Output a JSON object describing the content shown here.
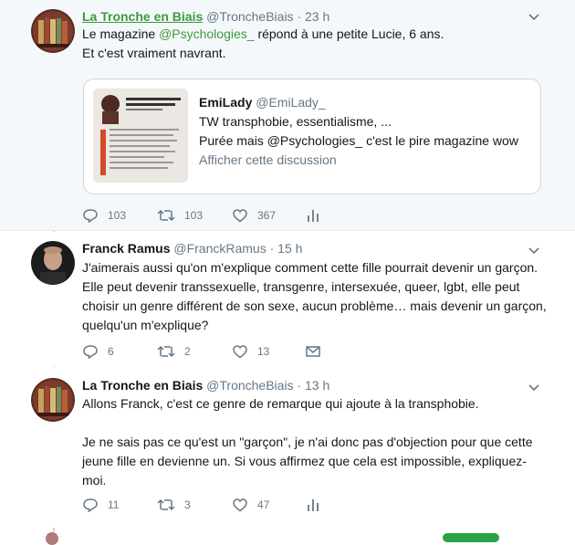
{
  "tweets": [
    {
      "name": "La Tronche en Biais",
      "handle": "@TroncheBiais",
      "time": "23 h",
      "text_line1_pre": "Le magazine ",
      "text_line1_mention": "@Psychologies_",
      "text_line1_post": " répond à une petite Lucie, 6 ans.",
      "text_line2": "Et c'est vraiment navrant.",
      "replies": "103",
      "retweets": "103",
      "likes": "367"
    },
    {
      "name": "Franck Ramus",
      "handle": "@FranckRamus",
      "time": "15 h",
      "lines": [
        "J'aimerais aussi qu'on m'explique comment cette fille pourrait devenir un garçon.",
        "Elle peut devenir transsexuelle, transgenre, intersexuée, queer, lgbt, elle peut",
        "choisir un genre différent de son sexe, aucun problème… mais devenir un garçon,",
        "quelqu'un m'explique?"
      ],
      "replies": "6",
      "retweets": "2",
      "likes": "13"
    },
    {
      "name": "La Tronche en Biais",
      "handle": "@TroncheBiais",
      "time": "13 h",
      "lines": [
        "Allons Franck, c'est ce genre de remarque qui ajoute à la transphobie.",
        "Je ne sais pas ce qu'est un \"garçon\", je n'ai donc pas d'objection pour que cette",
        "jeune fille en devienne un.  Si vous affirmez que cela est impossible, expliquez-",
        "moi."
      ],
      "replies": "11",
      "retweets": "3",
      "likes": "47"
    }
  ],
  "quote": {
    "name": "EmiLady",
    "handle": "@EmiLady_",
    "line1": "TW transphobie, essentialisme, ...",
    "line2": "Purée mais @Psychologies_ c'est le pire magazine wow",
    "link": "Afficher cette discussion"
  },
  "separator": "·",
  "colors": {
    "accent": "#3d9a3e",
    "muted": "#657786",
    "border": "#e6ecf0",
    "highlight_bg": "#f5f8fa"
  },
  "icons": [
    "reply-icon",
    "retweet-icon",
    "like-icon",
    "analytics-icon",
    "message-icon",
    "caret-down-icon"
  ]
}
